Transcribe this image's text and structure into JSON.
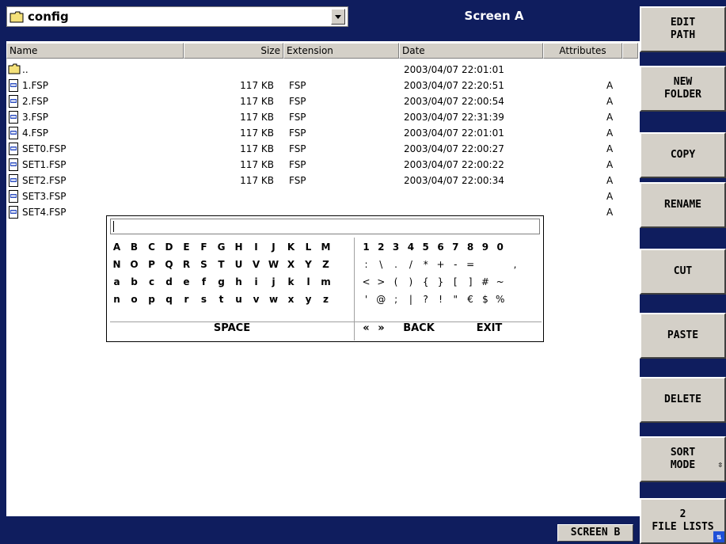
{
  "topbar": {
    "path": "config",
    "screen_title": "Screen A"
  },
  "columns": {
    "name": "Name",
    "size": "Size",
    "extension": "Extension",
    "date": "Date",
    "attributes": "Attributes"
  },
  "files": [
    {
      "name": "..",
      "size": "",
      "ext": "",
      "date": "2003/04/07 22:01:01",
      "attr": "",
      "icon": "folder-icon"
    },
    {
      "name": "1.FSP",
      "size": "117 KB",
      "ext": "FSP",
      "date": "2003/04/07 22:20:51",
      "attr": "A",
      "icon": "file-icon"
    },
    {
      "name": "2.FSP",
      "size": "117 KB",
      "ext": "FSP",
      "date": "2003/04/07 22:00:54",
      "attr": "A",
      "icon": "file-icon"
    },
    {
      "name": "3.FSP",
      "size": "117 KB",
      "ext": "FSP",
      "date": "2003/04/07 22:31:39",
      "attr": "A",
      "icon": "file-icon"
    },
    {
      "name": "4.FSP",
      "size": "117 KB",
      "ext": "FSP",
      "date": "2003/04/07 22:01:01",
      "attr": "A",
      "icon": "file-icon"
    },
    {
      "name": "SET0.FSP",
      "size": "117 KB",
      "ext": "FSP",
      "date": "2003/04/07 22:00:27",
      "attr": "A",
      "icon": "file-icon"
    },
    {
      "name": "SET1.FSP",
      "size": "117 KB",
      "ext": "FSP",
      "date": "2003/04/07 22:00:22",
      "attr": "A",
      "icon": "file-icon"
    },
    {
      "name": "SET2.FSP",
      "size": "117 KB",
      "ext": "FSP",
      "date": "2003/04/07 22:00:34",
      "attr": "A",
      "icon": "file-icon"
    },
    {
      "name": "SET3.FSP",
      "size": "",
      "ext": "",
      "date": "",
      "attr": "A",
      "icon": "file-icon"
    },
    {
      "name": "SET4.FSP",
      "size": "",
      "ext": "",
      "date": "",
      "attr": "A",
      "icon": "file-icon"
    }
  ],
  "keyboard": {
    "input_value": "",
    "letter_rows": [
      [
        "A",
        "B",
        "C",
        "D",
        "E",
        "F",
        "G",
        "H",
        "I",
        "J",
        "K",
        "L",
        "M"
      ],
      [
        "N",
        "O",
        "P",
        "Q",
        "R",
        "S",
        "T",
        "U",
        "V",
        "W",
        "X",
        "Y",
        "Z"
      ],
      [
        "a",
        "b",
        "c",
        "d",
        "e",
        "f",
        "g",
        "h",
        "i",
        "j",
        "k",
        "l",
        "m"
      ],
      [
        "n",
        "o",
        "p",
        "q",
        "r",
        "s",
        "t",
        "u",
        "v",
        "w",
        "x",
        "y",
        "z"
      ]
    ],
    "symbol_rows": [
      [
        "1",
        "2",
        "3",
        "4",
        "5",
        "6",
        "7",
        "8",
        "9",
        "0",
        "",
        ""
      ],
      [
        ":",
        "\\",
        ".",
        "/",
        "*",
        "+",
        "-",
        "=",
        "",
        "",
        ",",
        ""
      ],
      [
        "<",
        ">",
        "(",
        ")",
        "{",
        "}",
        "[",
        "]",
        "#",
        "~",
        "",
        ""
      ],
      [
        "'",
        "@",
        ";",
        "|",
        "?",
        "!",
        "\"",
        "€",
        "$",
        "%",
        "",
        ""
      ]
    ],
    "space_label": "SPACE",
    "left_label": "«",
    "right_label": "»",
    "back_label": "BACK",
    "exit_label": "EXIT"
  },
  "softkeys": [
    [
      "EDIT",
      "PATH"
    ],
    [
      "NEW",
      "FOLDER"
    ],
    [
      "COPY"
    ],
    [
      "RENAME"
    ],
    [
      "CUT"
    ],
    [
      "PASTE"
    ],
    [
      "DELETE"
    ],
    [
      "SORT",
      "MODE"
    ],
    [
      "2",
      "FILE LISTS"
    ]
  ],
  "bottom": {
    "screen_b": "SCREEN B",
    "sort_arrow": "⇳",
    "corner_symbol": "⇅"
  },
  "colors": {
    "background": "#0f1d5e",
    "panel": "#ffffff",
    "button": "#d4d0c8",
    "accent": "#1f50d8"
  }
}
